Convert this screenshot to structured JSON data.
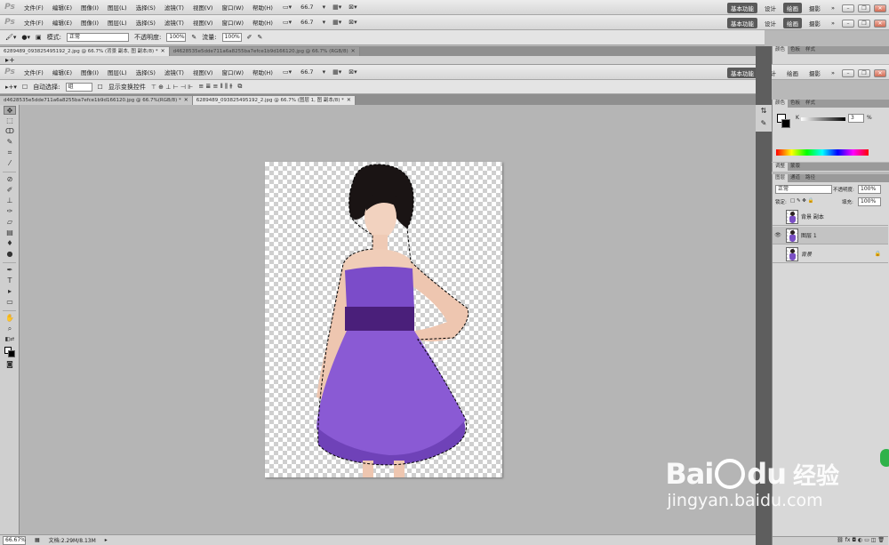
{
  "app": {
    "logo": "Ps"
  },
  "menus": [
    "文件(F)",
    "编辑(E)",
    "图像(I)",
    "图层(L)",
    "选择(S)",
    "滤镜(T)",
    "视图(V)",
    "窗口(W)",
    "帮助(H)"
  ],
  "zoom": "66.7",
  "workspaces": {
    "basic": "基本功能",
    "design": "设计",
    "paint": "绘画",
    "photo": "摄影",
    "more": "»"
  },
  "brush_options": {
    "mode_label": "模式:",
    "mode_value": "正常",
    "opacity_label": "不透明度:",
    "opacity_value": "100%",
    "flow_label": "流量:",
    "flow_value": "100%"
  },
  "tabs_top": {
    "tab1": "6289489_093825495192_2.jpg @ 66.7% (背景 副本, 图 副本/8) *",
    "tab2": "d4628535e5dde711a6a8255ba7efce1b9d166120.jpg @ 66.7% (RGB/8)"
  },
  "move_options": {
    "auto_select": "自动选择:",
    "auto_select_value": "组",
    "show_transform": "显示变换控件"
  },
  "tabs_main": {
    "tab1": "d4628535e5dde711a6a8255ba7efce1b9d166120.jpg @ 66.7%(RGB/8) *",
    "tab2": "6289489_093825495192_2.jpg @ 66.7% (图层 1, 图 副本/8) *"
  },
  "status": {
    "zoom": "66.67%",
    "doc": "文档:2.29M/8.13M"
  },
  "color_panel": {
    "tabs": [
      "颜色",
      "色板",
      "样式"
    ],
    "k_label": "K",
    "k_value": "3",
    "k_unit": "%"
  },
  "adjust_panel": {
    "tabs": [
      "调整",
      "蒙版"
    ]
  },
  "layers_panel": {
    "tabs": [
      "图层",
      "通道",
      "路径"
    ],
    "blend_mode": "正常",
    "opacity_label": "不透明度:",
    "opacity_value": "100%",
    "lock_label": "锁定:",
    "fill_label": "填充:",
    "fill_value": "100%",
    "layers": [
      {
        "name": "背景 副本",
        "visible": false,
        "selected": false
      },
      {
        "name": "图层 1",
        "visible": true,
        "selected": true
      },
      {
        "name": "背景",
        "visible": false,
        "selected": false,
        "locked": true
      }
    ]
  },
  "watermark": {
    "brand": "Bai",
    "brand2": "du",
    "cn": "经验",
    "url": "jingyan.baidu.com"
  }
}
